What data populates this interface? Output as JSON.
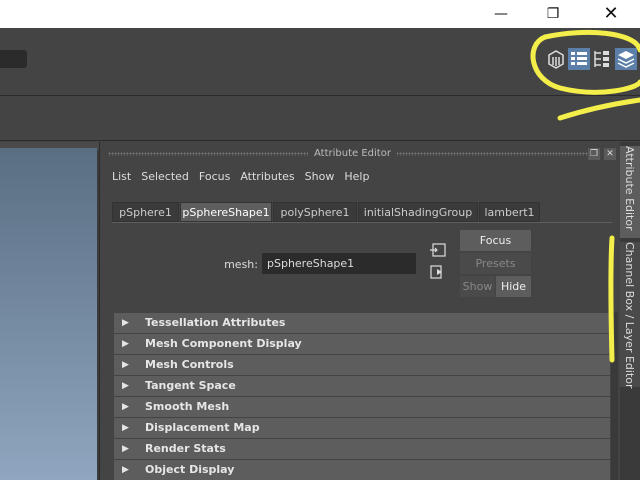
{
  "window": {
    "minimize_glyph": "—",
    "maximize_glyph": "❐",
    "close_glyph": "✕"
  },
  "toolbar": {
    "icons": [
      "modeling-toolkit-icon",
      "attribute-editor-icon",
      "tool-settings-icon",
      "channel-box-icon"
    ]
  },
  "attribute_editor": {
    "title": "Attribute Editor",
    "menu": [
      "List",
      "Selected",
      "Focus",
      "Attributes",
      "Show",
      "Help"
    ],
    "tabs": [
      {
        "label": "pSphere1",
        "active": false
      },
      {
        "label": "pSphereShape1",
        "active": true
      },
      {
        "label": "polySphere1",
        "active": false
      },
      {
        "label": "initialShadingGroup",
        "active": false
      },
      {
        "label": "lambert1",
        "active": false
      }
    ],
    "mesh_label": "mesh:",
    "mesh_value": "pSphereShape1",
    "focus_label": "Focus",
    "presets_label": "Presets",
    "show_label": "Show",
    "hide_label": "Hide",
    "sections": [
      "Tessellation Attributes",
      "Mesh Component Display",
      "Mesh Controls",
      "Tangent Space",
      "Smooth Mesh",
      "Displacement Map",
      "Render Stats",
      "Object Display"
    ]
  },
  "side_tabs": {
    "attribute_editor": "Attribute Editor",
    "channel_box": "Channel Box / Layer Editor"
  },
  "colors": {
    "annotation": "#f4ee4a",
    "panel": "#444444",
    "section": "#5d5d5d"
  }
}
